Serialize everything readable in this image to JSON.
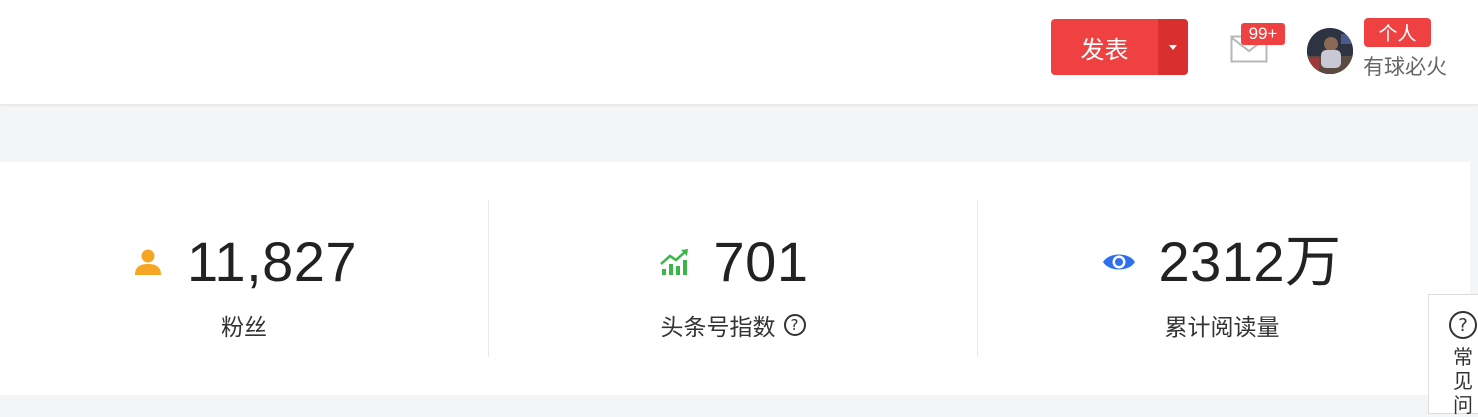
{
  "header": {
    "publish_label": "发表",
    "mail_badge": "99+",
    "role_badge": "个人",
    "username": "有球必火"
  },
  "stats": [
    {
      "icon": "user-icon",
      "value": "11,827",
      "label": "粉丝",
      "icon_color": "#f5a623"
    },
    {
      "icon": "trend-up-icon",
      "value": "701",
      "label": "头条号指数",
      "help": "?",
      "icon_color": "#3ab54a"
    },
    {
      "icon": "eye-icon",
      "value": "2312万",
      "label": "累计阅读量",
      "icon_color": "#2f6ff0"
    }
  ],
  "faq": {
    "icon": "?",
    "label": "常见问"
  },
  "colors": {
    "accent": "#f04142",
    "accent_dark": "#d9302f",
    "text": "#222222",
    "muted": "#666666",
    "page_bg": "#f4f5f6"
  }
}
